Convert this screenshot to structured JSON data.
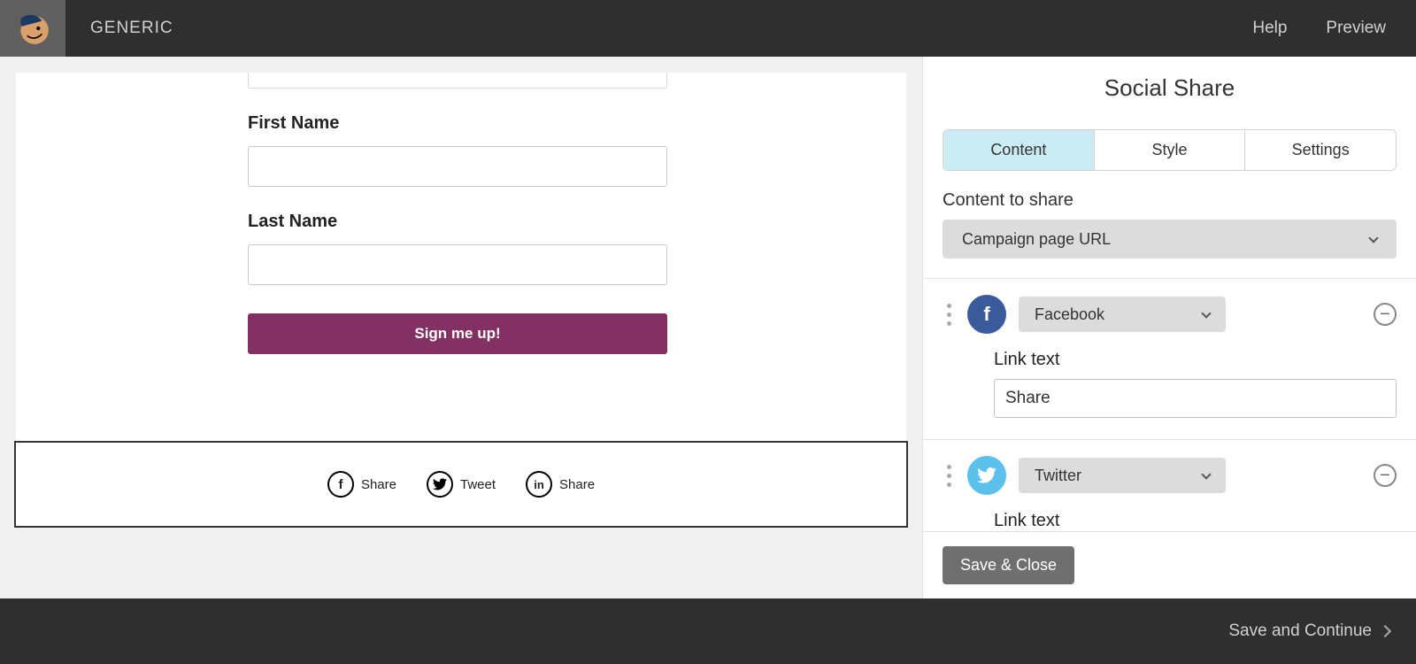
{
  "topbar": {
    "campaign_name": "GENERIC",
    "help": "Help",
    "preview": "Preview"
  },
  "form": {
    "first_name_label": "First Name",
    "last_name_label": "Last Name",
    "signup_button": "Sign me up!"
  },
  "share_preview": {
    "items": [
      {
        "icon": "facebook",
        "label": "Share"
      },
      {
        "icon": "twitter",
        "label": "Tweet"
      },
      {
        "icon": "linkedin",
        "label": "Share"
      }
    ]
  },
  "panel": {
    "title": "Social Share",
    "tabs": {
      "content": "Content",
      "style": "Style",
      "settings": "Settings"
    },
    "content_to_share_label": "Content to share",
    "content_to_share_value": "Campaign page URL",
    "services": [
      {
        "name": "Facebook",
        "icon": "facebook",
        "link_text_label": "Link text",
        "link_text_value": "Share"
      },
      {
        "name": "Twitter",
        "icon": "twitter",
        "link_text_label": "Link text",
        "link_text_value": ""
      }
    ],
    "save_close": "Save & Close"
  },
  "bottombar": {
    "save_continue": "Save and Continue"
  }
}
